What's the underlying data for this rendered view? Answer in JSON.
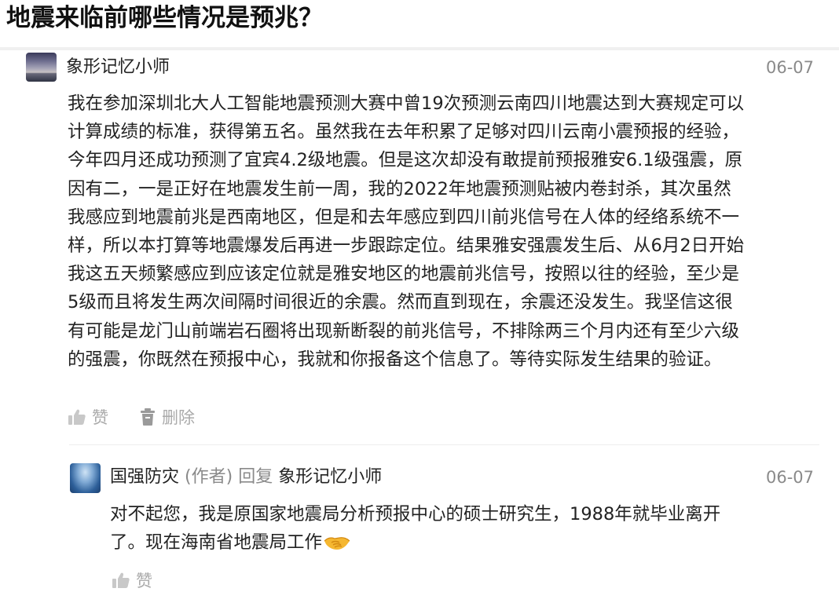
{
  "question": {
    "title": "地震来临前哪些情况是预兆？"
  },
  "comment": {
    "author": "象形记忆小师",
    "date": "06-07",
    "lines": [
      "我在参加深圳北大人工智能地震预测大赛中曾19次预测云南四川地震达到大赛规定可以",
      "计算成绩的标准，获得第五名。虽然我在去年积累了足够对四川云南小震预报的经验，",
      "今年四月还成功预测了宜宾4.2级地震。但是这次却没有敢提前预报雅安6.1级强震，原",
      "因有二，一是正好在地震发生前一周，我的2022年地震预测贴被内卷封杀，其次虽然",
      "我感应到地震前兆是西南地区，但是和去年感应到四川前兆信号在人体的经络系统不一",
      "样，所以本打算等地震爆发后再进一步跟踪定位。结果雅安强震发生后、从6月2日开始",
      "我这五天频繁感应到应该定位就是雅安地区的地震前兆信号，按照以往的经验，至少是",
      "5级而且将发生两次间隔时间很近的余震。然而直到现在，余震还没发生。我坚信这很",
      "有可能是龙门山前端岩石圈将出现新断裂的前兆信号，不排除两三个月内还有至少六级",
      "的强震，你既然在预报中心，我就和你报备这个信息了。等待实际发生结果的验证。"
    ],
    "like_label": "赞",
    "delete_label": "删除"
  },
  "reply": {
    "author": "国强防灾",
    "author_tag": "(作者)",
    "reply_word": "回复",
    "reply_to": "象形记忆小师",
    "date": "06-07",
    "lines": [
      "对不起您，我是原国家地震局分析预报中心的硕士研究生，1988年就毕业离开",
      "了。现在海南省地震局工作"
    ],
    "emoji": "handshake-emoji",
    "like_label": "赞"
  },
  "icons": {
    "like": "thumbs-up-icon",
    "delete": "trash-icon"
  },
  "colors": {
    "text": "#222222",
    "muted": "#8a8a8a",
    "action": "#aaaaaa"
  }
}
